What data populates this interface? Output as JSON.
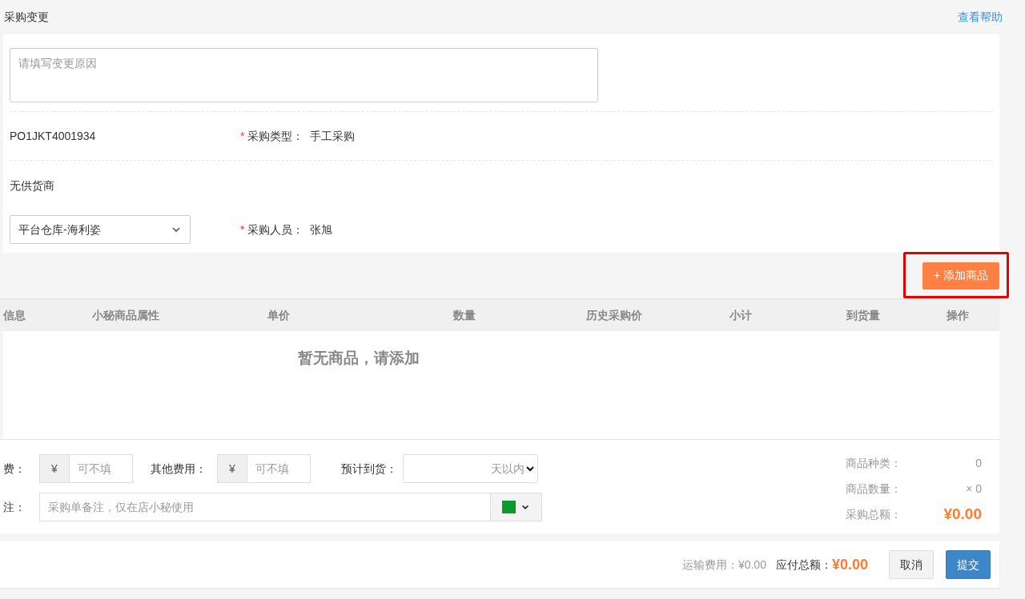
{
  "header": {
    "title": "采购变更",
    "help_link": "查看帮助"
  },
  "reason_field": {
    "placeholder": "请填写变更原因"
  },
  "order_number": "PO1JKT4001934",
  "purchase_type": {
    "required_mark": "*",
    "label": "采购类型：",
    "value": "手工采购"
  },
  "supplier": "无供货商",
  "warehouse_select": {
    "value": "平台仓库-海利姿"
  },
  "purchaser": {
    "required_mark": "*",
    "label": "采购人员：",
    "value": "张旭"
  },
  "add_button": {
    "label": "+ 添加商品",
    "highlighted": true
  },
  "table": {
    "columns": [
      "信息",
      "小秘商品属性",
      "单价",
      "数量",
      "历史采购价",
      "小计",
      "到货量",
      "操作"
    ],
    "empty_message": "暂无商品，请添加"
  },
  "fees": [
    {
      "label": "费：",
      "currency": "¥",
      "placeholder": "可不填"
    },
    {
      "label": "其他费用：",
      "currency": "¥",
      "placeholder": "可不填"
    }
  ],
  "arrival": {
    "label": "预计到货：",
    "suffix": "天以内"
  },
  "note": {
    "label": "注：",
    "placeholder": "采购单备注，仅在店小秘使用",
    "color": "#0b9a2c"
  },
  "summary": [
    {
      "label": "商品种类：",
      "value": "0",
      "kind": "plain"
    },
    {
      "label": "商品数量：",
      "value": "× 0",
      "kind": "plain"
    },
    {
      "label": "采购总额：",
      "value": "¥0.00",
      "kind": "total"
    }
  ],
  "footer": {
    "shipping_label": "运输费用：",
    "shipping_value": "¥0.00",
    "payable_label": "应付总额：",
    "payable_value": "¥0.00",
    "buttons": [
      {
        "label": "取消",
        "kind": "default"
      },
      {
        "label": "提交",
        "kind": "primary"
      }
    ]
  }
}
